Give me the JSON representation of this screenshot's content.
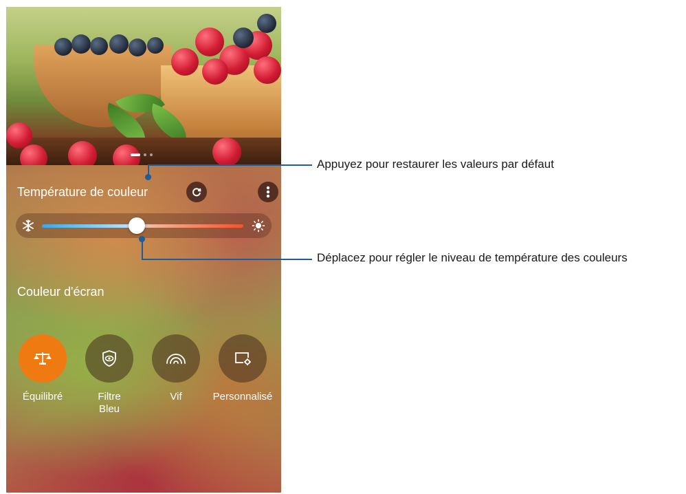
{
  "screen": {
    "title": "Température de couleur",
    "section_label": "Couleur d'écran",
    "slider": {
      "value_fraction": 0.47,
      "left_icon": "snowflake-icon",
      "right_icon": "sun-icon"
    },
    "pager": {
      "count": 3,
      "active": 0
    },
    "modes": [
      {
        "label": "Équilibré",
        "icon": "balance-scale-icon",
        "active": true
      },
      {
        "label": "Filtre\nBleu",
        "icon": "eye-shield-icon",
        "active": false
      },
      {
        "label": "Vif",
        "icon": "rainbow-icon",
        "active": false
      },
      {
        "label": "Personnalisé",
        "icon": "custom-screen-icon",
        "active": false
      }
    ]
  },
  "callouts": {
    "reset": "Appuyez pour restaurer les valeurs par défaut",
    "slider": "Déplacez pour régler le niveau de température des couleurs"
  },
  "colors": {
    "accent": "#f07a12",
    "callout": "#1f5c99"
  }
}
